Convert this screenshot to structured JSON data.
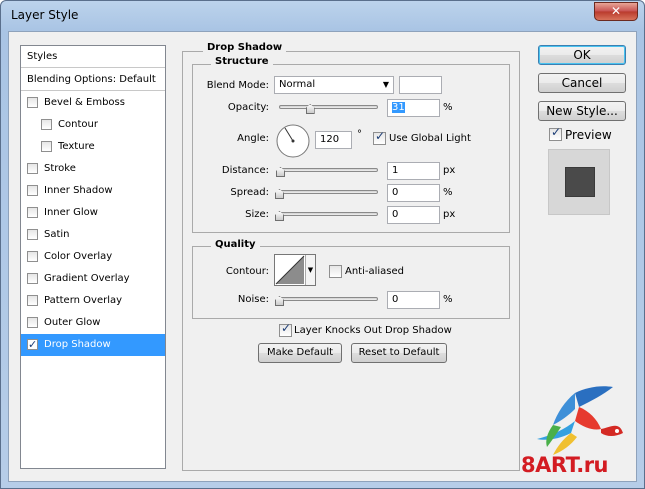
{
  "window": {
    "title": "Layer Style",
    "close_glyph": "✕"
  },
  "styles_list": {
    "header": "Styles",
    "blending": "Blending Options: Default",
    "items": [
      {
        "label": "Bevel & Emboss",
        "checked": false,
        "indent": false
      },
      {
        "label": "Contour",
        "checked": false,
        "indent": true
      },
      {
        "label": "Texture",
        "checked": false,
        "indent": true
      },
      {
        "label": "Stroke",
        "checked": false,
        "indent": false
      },
      {
        "label": "Inner Shadow",
        "checked": false,
        "indent": false
      },
      {
        "label": "Inner Glow",
        "checked": false,
        "indent": false
      },
      {
        "label": "Satin",
        "checked": false,
        "indent": false
      },
      {
        "label": "Color Overlay",
        "checked": false,
        "indent": false
      },
      {
        "label": "Gradient Overlay",
        "checked": false,
        "indent": false
      },
      {
        "label": "Pattern Overlay",
        "checked": false,
        "indent": false
      },
      {
        "label": "Outer Glow",
        "checked": false,
        "indent": false
      },
      {
        "label": "Drop Shadow",
        "checked": true,
        "indent": false,
        "selected": true
      }
    ]
  },
  "drop_shadow": {
    "title": "Drop Shadow",
    "structure": {
      "title": "Structure",
      "blend_mode_label": "Blend Mode:",
      "blend_mode_value": "Normal",
      "opacity_label": "Opacity:",
      "opacity_value": "31",
      "opacity_unit": "%",
      "opacity_level": 0.31,
      "angle_label": "Angle:",
      "angle_value": "120",
      "angle_unit": "°",
      "global_light_label": "Use Global Light",
      "global_light_checked": true,
      "distance_label": "Distance:",
      "distance_value": "1",
      "distance_unit": "px",
      "spread_label": "Spread:",
      "spread_value": "0",
      "spread_unit": "%",
      "size_label": "Size:",
      "size_value": "0",
      "size_unit": "px"
    },
    "quality": {
      "title": "Quality",
      "contour_label": "Contour:",
      "anti_aliased_label": "Anti-aliased",
      "anti_aliased_checked": false,
      "noise_label": "Noise:",
      "noise_value": "0",
      "noise_unit": "%"
    },
    "knockout_label": "Layer Knocks Out Drop Shadow",
    "knockout_checked": true,
    "make_default_label": "Make Default",
    "reset_default_label": "Reset to Default"
  },
  "buttons": {
    "ok": "OK",
    "cancel": "Cancel",
    "new_style": "New Style...",
    "preview_label": "Preview",
    "preview_checked": true
  },
  "watermark": {
    "text": "8ART.ru"
  },
  "colors": {
    "selection": "#3399ff",
    "preview_bg": "#d7d7d7",
    "preview_square": "#4a4a4a",
    "watermark": "#d31c22"
  }
}
